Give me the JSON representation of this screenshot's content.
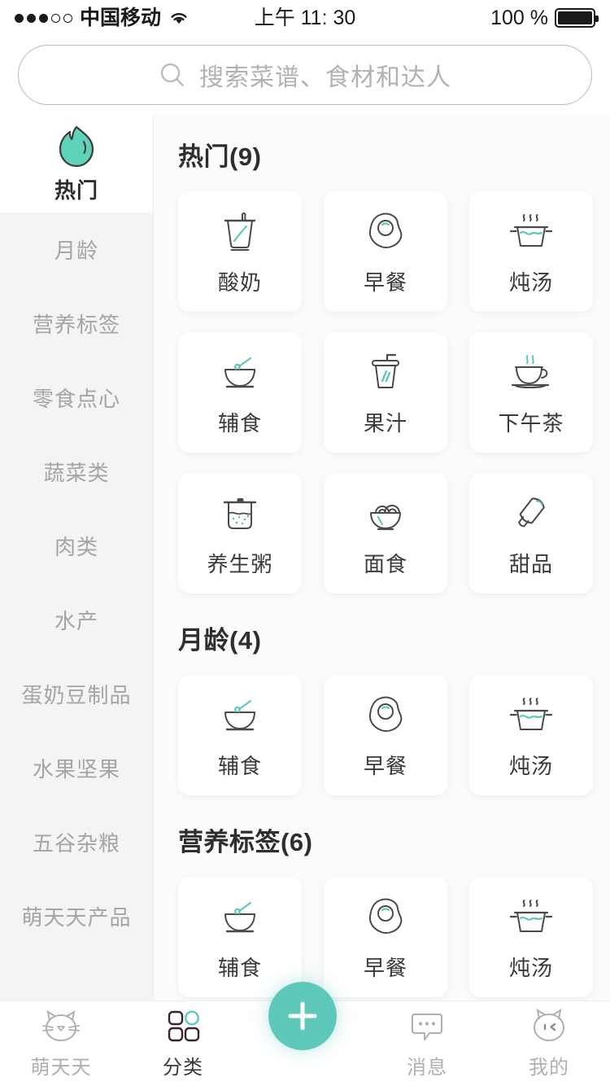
{
  "status_bar": {
    "signal_dots_filled": 3,
    "signal_dots_total": 5,
    "carrier": "中国移动",
    "wifi_icon": "wifi-icon",
    "time": "上午 11: 30",
    "battery_percent": "100 %",
    "battery_icon": "battery-full-icon"
  },
  "search": {
    "icon": "search-icon",
    "placeholder": "搜索菜谱、食材和达人",
    "value": ""
  },
  "sidebar": {
    "active_index": 0,
    "items": [
      {
        "label": "热门",
        "icon": "flame-icon",
        "active": true
      },
      {
        "label": "月龄",
        "active": false
      },
      {
        "label": "营养标签",
        "active": false
      },
      {
        "label": "零食点心",
        "active": false
      },
      {
        "label": "蔬菜类",
        "active": false
      },
      {
        "label": "肉类",
        "active": false
      },
      {
        "label": "水产",
        "active": false
      },
      {
        "label": "蛋奶豆制品",
        "active": false
      },
      {
        "label": "水果坚果",
        "active": false
      },
      {
        "label": "五谷杂粮",
        "active": false
      },
      {
        "label": "萌天天产品",
        "active": false
      }
    ]
  },
  "sections": [
    {
      "title": "热门(9)",
      "items": [
        {
          "label": "酸奶",
          "icon": "yogurt-cup-icon"
        },
        {
          "label": "早餐",
          "icon": "fried-egg-icon"
        },
        {
          "label": "炖汤",
          "icon": "soup-pot-icon"
        },
        {
          "label": "辅食",
          "icon": "bowl-spoon-icon"
        },
        {
          "label": "果汁",
          "icon": "juice-cup-icon"
        },
        {
          "label": "下午茶",
          "icon": "teacup-icon"
        },
        {
          "label": "养生粥",
          "icon": "porridge-pot-icon"
        },
        {
          "label": "面食",
          "icon": "noodle-bowl-icon"
        },
        {
          "label": "甜品",
          "icon": "popsicle-icon"
        }
      ]
    },
    {
      "title": "月龄(4)",
      "items": [
        {
          "label": "辅食",
          "icon": "bowl-spoon-icon"
        },
        {
          "label": "早餐",
          "icon": "fried-egg-icon"
        },
        {
          "label": "炖汤",
          "icon": "soup-pot-icon"
        }
      ]
    },
    {
      "title": "营养标签(6)",
      "items": [
        {
          "label": "辅食",
          "icon": "bowl-spoon-icon"
        },
        {
          "label": "早餐",
          "icon": "fried-egg-icon"
        },
        {
          "label": "炖汤",
          "icon": "soup-pot-icon"
        }
      ]
    }
  ],
  "tabbar": {
    "active_index": 1,
    "items": [
      {
        "label": "萌天天",
        "icon": "cat-head-icon",
        "active": false
      },
      {
        "label": "分类",
        "icon": "grid-category-icon",
        "active": true
      },
      {
        "label": "消息",
        "icon": "chat-bubble-icon",
        "active": false
      },
      {
        "label": "我的",
        "icon": "cat-avatar-icon",
        "active": false
      }
    ],
    "fab": {
      "icon": "plus-icon",
      "label": ""
    }
  },
  "colors": {
    "accent": "#5ec9bb",
    "text_dark": "#2e2e2e",
    "text_muted": "#a5a5a5",
    "icon_stroke": "#4a4a4a",
    "page_bg": "#fbfbfb",
    "sidebar_bg": "#f4f4f4"
  }
}
